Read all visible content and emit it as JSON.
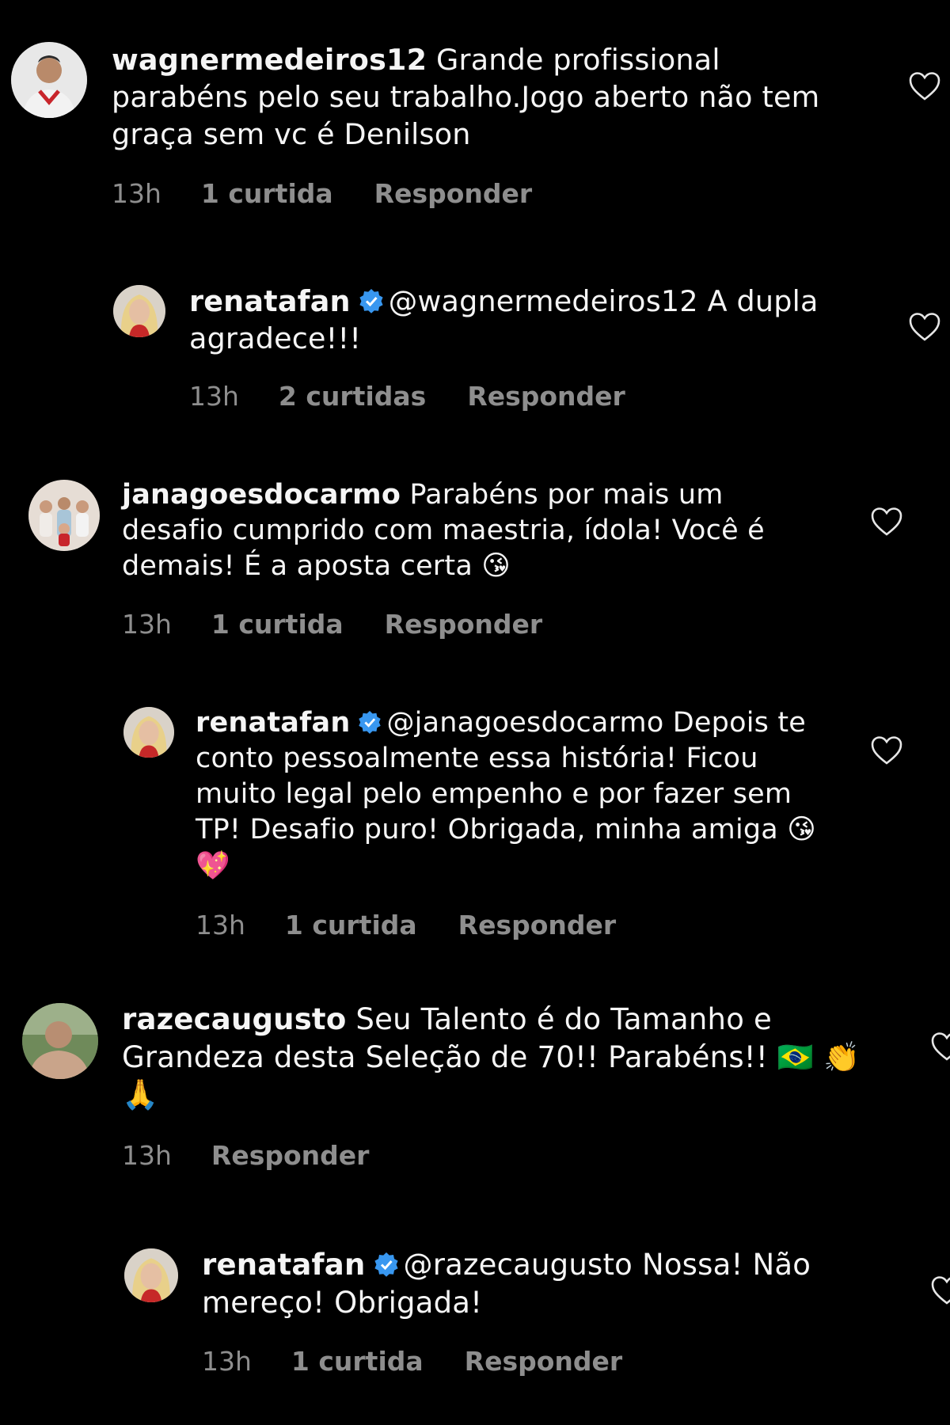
{
  "comments": [
    {
      "username": "wagnermedeiros12",
      "verified": false,
      "text": "Grande profissional parabéns pelo seu trabalho.Jogo aberto não tem graça sem vc é Denilson",
      "time": "13h",
      "likes": "1 curtida",
      "reply": "Responder"
    },
    {
      "username": "renatafan",
      "verified": true,
      "text": "@wagnermedeiros12 A dupla agradece!!!",
      "time": "13h",
      "likes": "2 curtidas",
      "reply": "Responder"
    },
    {
      "username": "janagoesdocarmo",
      "verified": false,
      "text": "Parabéns por mais um desafio cumprido com maestria, ídola! Você é demais! É a aposta certa",
      "emoji": "😘",
      "time": "13h",
      "likes": "1 curtida",
      "reply": "Responder"
    },
    {
      "username": "renatafan",
      "verified": true,
      "text": "@janagoesdocarmo Depois te conto pessoalmente essa história! Ficou muito legal pelo empenho e por fazer sem TP! Desafio puro! Obrigada, minha amiga",
      "emoji": "😘 💖",
      "time": "13h",
      "likes": "1 curtida",
      "reply": "Responder"
    },
    {
      "username": "razecaugusto",
      "verified": false,
      "text": "Seu Talento é do Tamanho e Grandeza desta Seleção de 70!! Parabéns!!",
      "emoji": "🇧🇷 👏 🙏",
      "time": "13h",
      "likes": "",
      "reply": "Responder"
    },
    {
      "username": "renatafan",
      "verified": true,
      "text": "@razecaugusto Nossa! Não mereço! Obrigada!",
      "time": "13h",
      "likes": "1 curtida",
      "reply": "Responder"
    }
  ],
  "colors": {
    "background": "#000000",
    "text": "#f5f5f5",
    "meta": "#8e8e8e",
    "verified": "#3897f0"
  }
}
